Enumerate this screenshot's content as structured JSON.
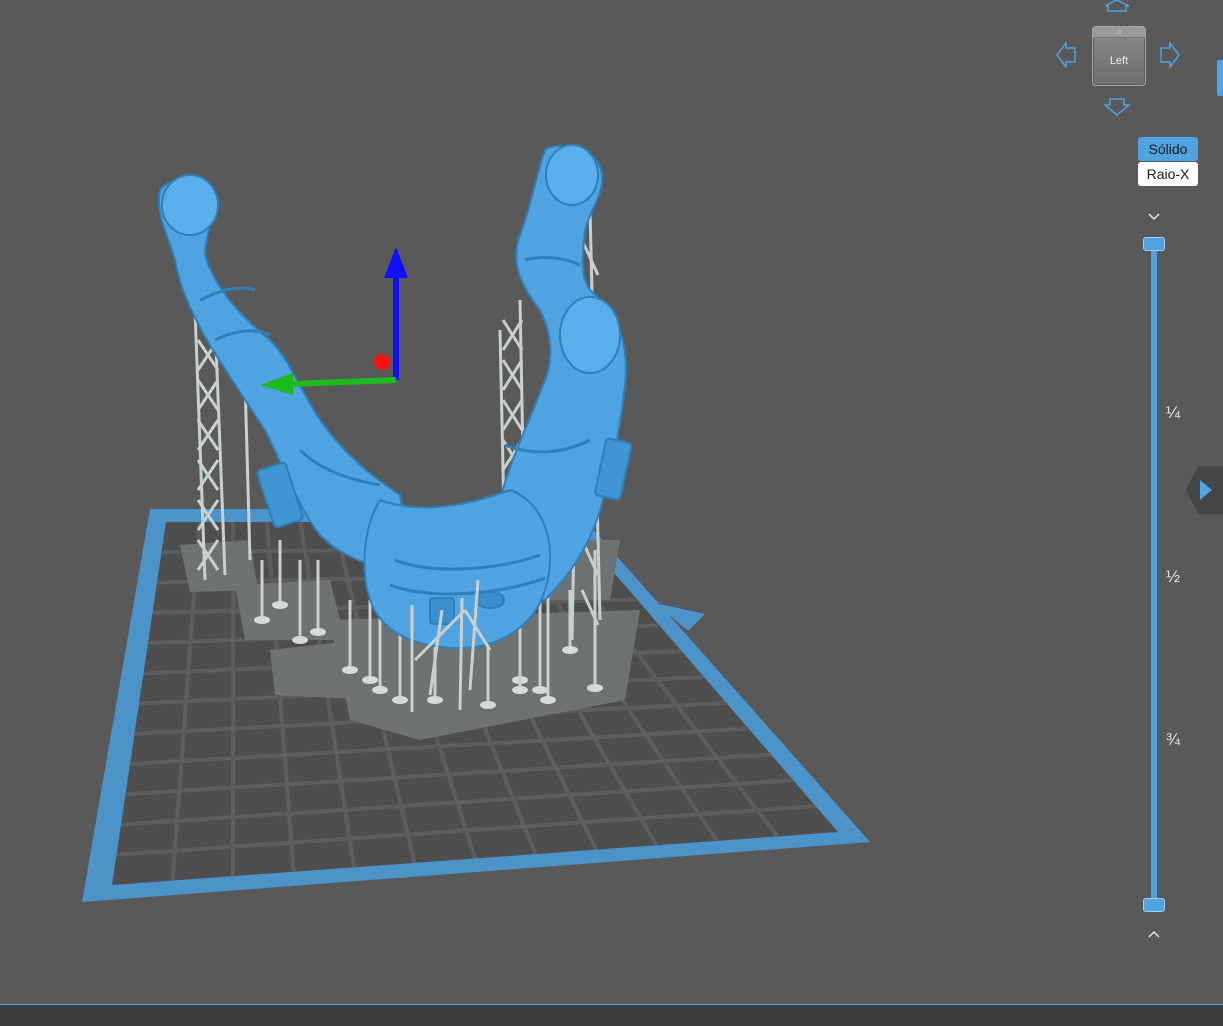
{
  "view_cube": {
    "face_label": "Left",
    "top_face_label": "⌂"
  },
  "render_modes": {
    "solid_label": "Sólido",
    "xray_label": "Raio-X",
    "active": "solid"
  },
  "layer_slider": {
    "tick_quarter": "¼",
    "tick_half": "½",
    "tick_three_quarter": "¾",
    "upper_value": 1.0,
    "lower_value": 0.0
  },
  "colors": {
    "viewport_background": "#595959",
    "model": "#4ea3e0",
    "supports": "#c8cfcf",
    "build_plate_frame": "#4b93c9",
    "build_plate_grid": "#3a3a3a",
    "axis_x": "#ff0000",
    "axis_y": "#1dba1d",
    "axis_z": "#1010ff",
    "accent": "#4ea3e0"
  },
  "icons": {
    "nav_up": "arrow-up-icon",
    "nav_down": "arrow-down-icon",
    "nav_left": "arrow-left-icon",
    "nav_right": "arrow-right-icon",
    "slider_up": "chevron-down-icon",
    "slider_down": "chevron-up-icon",
    "side_panel": "play-right-icon"
  }
}
